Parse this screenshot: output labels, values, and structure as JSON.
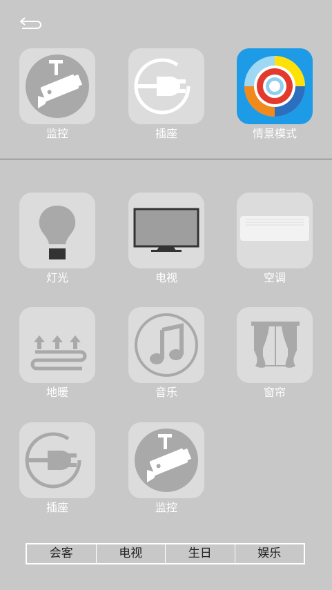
{
  "top_devices": [
    {
      "label": "监控",
      "icon": "camera-icon"
    },
    {
      "label": "插座",
      "icon": "plug-icon"
    },
    {
      "label": "情景模式",
      "icon": "scene-mode-icon"
    }
  ],
  "devices": [
    {
      "label": "灯光",
      "icon": "bulb-icon"
    },
    {
      "label": "电视",
      "icon": "tv-icon"
    },
    {
      "label": "空调",
      "icon": "air-conditioner-icon"
    },
    {
      "label": "地暖",
      "icon": "floor-heating-icon"
    },
    {
      "label": "音乐",
      "icon": "music-note-icon"
    },
    {
      "label": "窗帘",
      "icon": "curtain-icon"
    },
    {
      "label": "插座",
      "icon": "plug-icon"
    },
    {
      "label": "监控",
      "icon": "camera-icon"
    }
  ],
  "scenes": [
    "会客",
    "电视",
    "生日",
    "娱乐"
  ],
  "colors": {
    "background": "#c8c8c8",
    "tile": "#dcdcdc",
    "scene_tile": "#1e9be6",
    "icon_grey": "#a9a9a9",
    "label": "#ffffff"
  }
}
